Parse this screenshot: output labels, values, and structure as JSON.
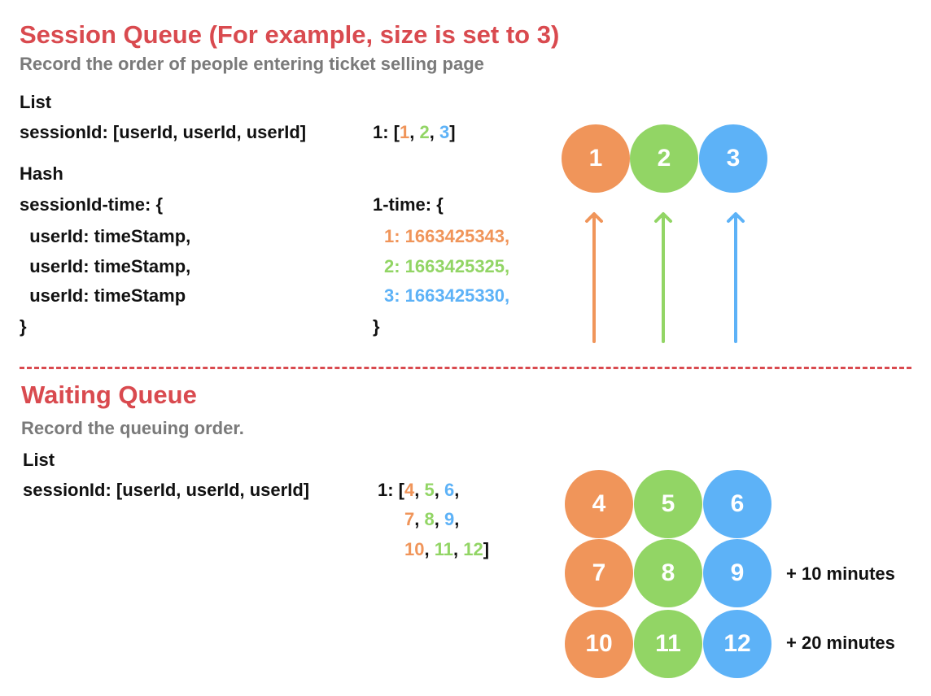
{
  "colors": {
    "orange": "#f0955a",
    "green": "#92d565",
    "blue": "#5db2f7",
    "title": "#d94a4f"
  },
  "session": {
    "title": "Session Queue (For example, size is set to 3)",
    "subtitle": "Record the order of people entering ticket selling page",
    "list_label": "List",
    "list_schema": "sessionId: [userId, userId, userId]",
    "list_example": {
      "prefix": "1: [",
      "items": [
        "1",
        "2",
        "3"
      ],
      "suffix": "]"
    },
    "hash_label": "Hash",
    "hash_schema": [
      "sessionId-time: {",
      "  userId: timeStamp,",
      "  userId: timeStamp,",
      "  userId: timeStamp",
      "}"
    ],
    "hash_example": {
      "open": "1-time: {",
      "entries": [
        "1: 1663425343,",
        "2: 1663425325,",
        "3: 1663425330,"
      ],
      "close": "}"
    },
    "circles": [
      "1",
      "2",
      "3"
    ]
  },
  "waiting": {
    "title": "Waiting Queue",
    "subtitle": "Record the queuing order.",
    "list_label": "List",
    "list_schema": "sessionId: [userId, userId, userId]",
    "list_example": {
      "prefix": "1: [",
      "rows": [
        [
          "4",
          "5",
          "6"
        ],
        [
          "7",
          "8",
          "9"
        ],
        [
          "10",
          "11",
          "12"
        ]
      ],
      "suffix": "]"
    },
    "circles": [
      [
        "4",
        "5",
        "6"
      ],
      [
        "7",
        "8",
        "9"
      ],
      [
        "10",
        "11",
        "12"
      ]
    ],
    "row_notes": [
      "",
      "+ 10 minutes",
      "+ 20 minutes"
    ]
  }
}
